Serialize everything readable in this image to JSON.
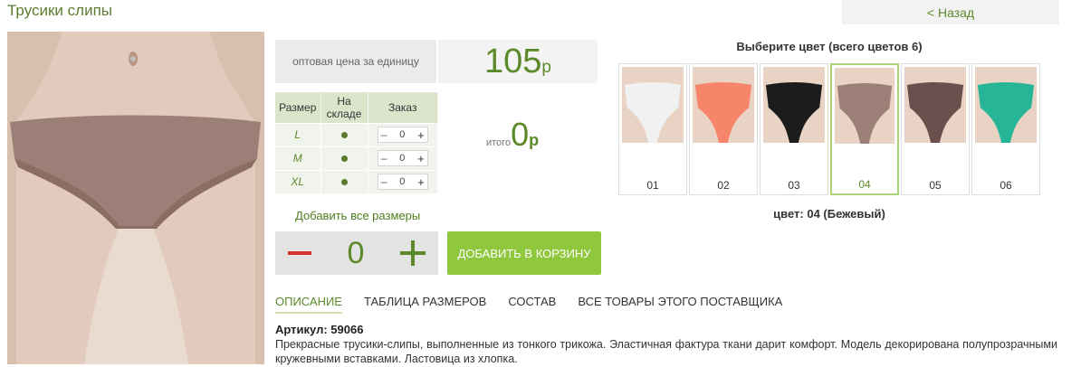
{
  "header": {
    "title": "Трусики слипы",
    "back_label": "< Назад"
  },
  "price": {
    "label": "оптовая цена за единицу",
    "value": "105",
    "currency": "р"
  },
  "size_table": {
    "headers": [
      "Размер",
      "На складе",
      "Заказ"
    ],
    "rows": [
      {
        "size": "L",
        "in_stock": true,
        "qty": "0"
      },
      {
        "size": "M",
        "in_stock": true,
        "qty": "0"
      },
      {
        "size": "XL",
        "in_stock": true,
        "qty": "0"
      }
    ],
    "stepper_minus": "–",
    "stepper_plus": "+"
  },
  "total": {
    "label": "итого",
    "value": "0",
    "currency": "р"
  },
  "add_all_label": "Добавить все размеры",
  "quantity": {
    "value": "0"
  },
  "cart_button_label": "ДОБАВИТЬ В КОРЗИНУ",
  "colors": {
    "title": "Выберите цвет (всего цветов 6)",
    "items": [
      {
        "number": "01",
        "color": "#f1f1f1"
      },
      {
        "number": "02",
        "color": "#f7856a"
      },
      {
        "number": "03",
        "color": "#1c1c1c"
      },
      {
        "number": "04",
        "color": "#9c8078"
      },
      {
        "number": "05",
        "color": "#6b4f4c"
      },
      {
        "number": "06",
        "color": "#27b597"
      }
    ],
    "selected_index": 3,
    "caption": "цвет: 04 (Бежевый)"
  },
  "tabs": [
    {
      "label": "ОПИСАНИЕ",
      "active": true
    },
    {
      "label": "ТАБЛИЦА РАЗМЕРОВ",
      "active": false
    },
    {
      "label": "СОСТАВ",
      "active": false
    },
    {
      "label": "ВСЕ ТОВАРЫ ЭТОГО ПОСТАВЩИКА",
      "active": false
    }
  ],
  "article": "Артикул: 59066",
  "description": "Прекрасные трусики-слипы, выполненные из тонкого трикожа. Эластичная фактура ткани дарит комфорт. Модель декорирована полупрозрачными кружевными вставками. Ластовица из хлопка.",
  "theme": {
    "accent": "#5c8a2a",
    "button": "#8fc73d",
    "minus": "#d4302b"
  }
}
